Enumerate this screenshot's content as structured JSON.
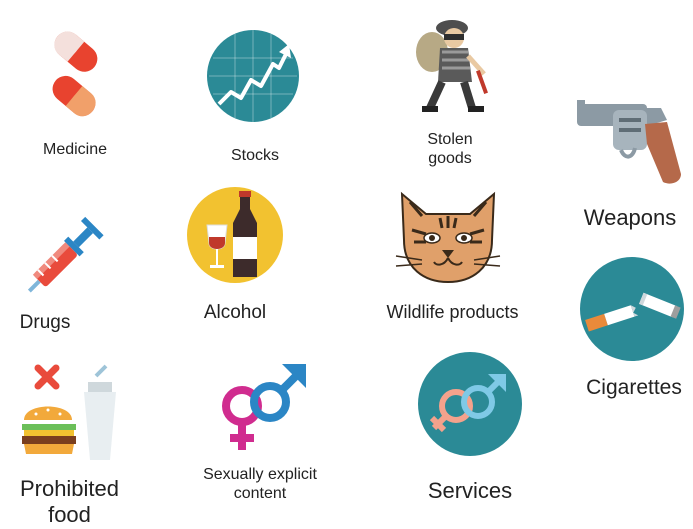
{
  "items": {
    "medicine": {
      "label": "Medicine",
      "icon": "pill-capsule-icon"
    },
    "stocks": {
      "label": "Stocks",
      "icon": "stock-chart-icon"
    },
    "stolen_goods": {
      "label_line1": "Stolen",
      "label_line2": "goods",
      "icon": "thief-icon"
    },
    "weapons": {
      "label": "Weapons",
      "icon": "revolver-icon"
    },
    "drugs": {
      "label": "Drugs",
      "icon": "syringe-icon"
    },
    "alcohol": {
      "label": "Alcohol",
      "icon": "wine-icon"
    },
    "wildlife": {
      "label": "Wildlife products",
      "icon": "tiger-face-icon"
    },
    "cigarettes": {
      "label": "Cigarettes",
      "icon": "cigarette-icon"
    },
    "prohibited_food": {
      "label_line1": "Prohibited",
      "label_line2": "food",
      "icon": "prohibited-food-icon"
    },
    "sexually_explicit": {
      "label_line1": "Sexually explicit",
      "label_line2": "content",
      "icon": "gender-symbols-icon"
    },
    "services": {
      "label": "Services",
      "icon": "gender-symbols-circle-icon"
    }
  },
  "colors": {
    "teal": "#2b8a96",
    "red": "#e94b3c",
    "yellow": "#f2c230",
    "blue": "#2b86c5",
    "magenta": "#d02c8f",
    "gun_gray": "#8c9aa4",
    "gun_brown": "#b5694a"
  }
}
